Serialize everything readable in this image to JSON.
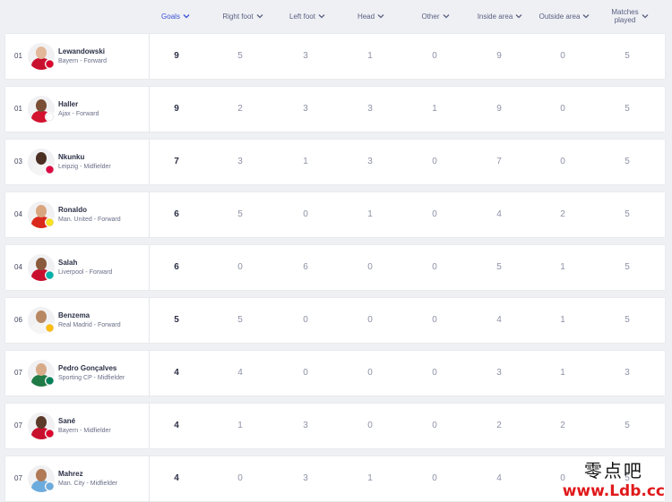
{
  "columns": [
    {
      "label": "Goals",
      "active": true
    },
    {
      "label": "Right foot",
      "active": false
    },
    {
      "label": "Left foot",
      "active": false
    },
    {
      "label": "Head",
      "active": false
    },
    {
      "label": "Other",
      "active": false
    },
    {
      "label": "Inside area",
      "active": false
    },
    {
      "label": "Outside area",
      "active": false
    },
    {
      "label": "Matches\nplayed",
      "active": false
    }
  ],
  "players": [
    {
      "rank": "01",
      "name": "Lewandowski",
      "meta": "Bayern - Forward",
      "stats": [
        "9",
        "5",
        "3",
        "1",
        "0",
        "9",
        "0",
        "5"
      ],
      "skin": "#e2b79a",
      "kit": "#c8102e",
      "badge": "#dc052d"
    },
    {
      "rank": "01",
      "name": "Haller",
      "meta": "Ajax - Forward",
      "stats": [
        "9",
        "2",
        "3",
        "3",
        "1",
        "9",
        "0",
        "5"
      ],
      "skin": "#7a4e35",
      "kit": "#d2122e",
      "badge": "#ffffff"
    },
    {
      "rank": "03",
      "name": "Nkunku",
      "meta": "Leipzig - Midfielder",
      "stats": [
        "7",
        "3",
        "1",
        "3",
        "0",
        "7",
        "0",
        "5"
      ],
      "skin": "#4a2f22",
      "kit": "#f4f4f4",
      "badge": "#dd0741"
    },
    {
      "rank": "04",
      "name": "Ronaldo",
      "meta": "Man. United - Forward",
      "stats": [
        "6",
        "5",
        "0",
        "1",
        "0",
        "4",
        "2",
        "5"
      ],
      "skin": "#d9a57f",
      "kit": "#da291c",
      "badge": "#fbe122"
    },
    {
      "rank": "04",
      "name": "Salah",
      "meta": "Liverpool - Forward",
      "stats": [
        "6",
        "0",
        "6",
        "0",
        "0",
        "5",
        "1",
        "5"
      ],
      "skin": "#8a5a3c",
      "kit": "#c8102e",
      "badge": "#00b2a9"
    },
    {
      "rank": "06",
      "name": "Benzema",
      "meta": "Real Madrid - Forward",
      "stats": [
        "5",
        "5",
        "0",
        "0",
        "0",
        "4",
        "1",
        "5"
      ],
      "skin": "#b88763",
      "kit": "#f5f5f5",
      "badge": "#febe10"
    },
    {
      "rank": "07",
      "name": "Pedro Gonçalves",
      "meta": "Sporting CP - Midfielder",
      "stats": [
        "4",
        "4",
        "0",
        "0",
        "0",
        "3",
        "1",
        "3"
      ],
      "skin": "#d7ab88",
      "kit": "#1f7a45",
      "badge": "#008057"
    },
    {
      "rank": "07",
      "name": "Sané",
      "meta": "Bayern - Midfielder",
      "stats": [
        "4",
        "1",
        "3",
        "0",
        "0",
        "2",
        "2",
        "5"
      ],
      "skin": "#5b3a29",
      "kit": "#c8102e",
      "badge": "#dc052d"
    },
    {
      "rank": "07",
      "name": "Mahrez",
      "meta": "Man. City - Midfielder",
      "stats": [
        "4",
        "0",
        "3",
        "1",
        "0",
        "4",
        "0",
        "5"
      ],
      "skin": "#b07a56",
      "kit": "#6cabdd",
      "badge": "#6cabdd"
    }
  ],
  "watermark": {
    "line1": "零点吧",
    "line2": "www.Ldb.cc"
  },
  "colors": {
    "active_header": "#3a4fd6",
    "header": "#5a6082",
    "row_bg": "#ffffff",
    "page_bg": "#eef0f4"
  }
}
